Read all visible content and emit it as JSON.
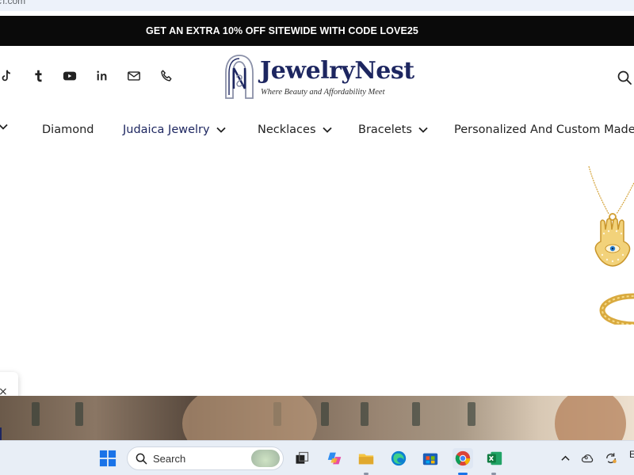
{
  "browser": {
    "url_fragment": "ст.com"
  },
  "promo": {
    "text": "GET AN EXTRA 10% OFF SITEWIDE WITH CODE LOVE25"
  },
  "header": {
    "social": [
      "tiktok-icon",
      "tumblr-icon",
      "youtube-icon",
      "linkedin-icon",
      "mail-icon",
      "phone-icon"
    ],
    "logo": {
      "name": "JewelryNest",
      "tagline": "Where Beauty and Affordability Meet"
    }
  },
  "nav": {
    "items": [
      {
        "label": "Diamond",
        "has_dropdown": false
      },
      {
        "label": "Judaica Jewelry",
        "has_dropdown": true,
        "active": true
      },
      {
        "label": "Necklaces",
        "has_dropdown": true
      },
      {
        "label": "Bracelets",
        "has_dropdown": true
      },
      {
        "label": "Personalized And Custom Made",
        "has_dropdown": false
      }
    ]
  },
  "toast": {
    "close": "×"
  },
  "taskbar": {
    "search_label": "Search",
    "apps": [
      "windows-start-icon",
      "task-view-icon",
      "copilot-icon",
      "file-explorer-icon",
      "edge-icon",
      "store-icon",
      "chrome-icon",
      "excel-icon"
    ],
    "tray_text": "E"
  },
  "colors": {
    "brand": "#1d2660",
    "promo_bg": "#0a0a0a"
  }
}
